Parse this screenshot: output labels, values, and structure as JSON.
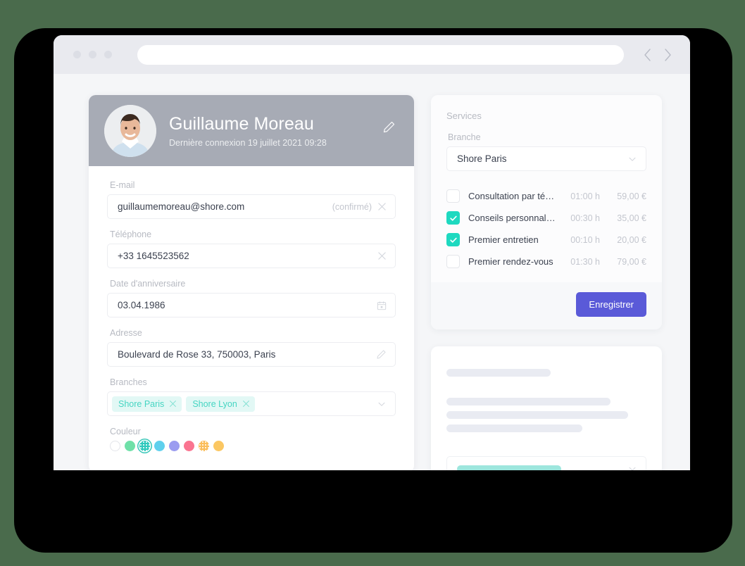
{
  "browser": {
    "url_value": "",
    "url_placeholder": "",
    "back_label": "‹",
    "forward_label": "›"
  },
  "profile": {
    "name": "Guillaume Moreau",
    "last_login": "Dernière connexion 19 juillet 2021 09:28",
    "edit_icon": "pencil-icon",
    "fields": [
      {
        "label": "E-mail",
        "value": "guillaumemoreau@shore.com",
        "hint": "(confirmé)",
        "icon": "close-icon"
      },
      {
        "label": "Téléphone",
        "value": "+33 1645523562",
        "hint": "",
        "icon": "close-icon"
      },
      {
        "label": "Date d'anniversaire",
        "value": "03.04.1986",
        "hint": "",
        "icon": "calendar-icon"
      },
      {
        "label": "Adresse",
        "value": "Boulevard de Rose 33, 750003, Paris",
        "hint": "",
        "icon": "pencil-icon"
      }
    ],
    "branches_label": "Branches",
    "branch_tags": [
      "Shore Paris",
      "Shore Lyon"
    ],
    "color_label": "Couleur",
    "colors": [
      {
        "hex": "#ffffff",
        "style": "empty",
        "selected": false
      },
      {
        "hex": "#6fe0a8",
        "style": "solid",
        "selected": false
      },
      {
        "hex": "#2ec9bd",
        "style": "dotted",
        "selected": true
      },
      {
        "hex": "#5fd0ed",
        "style": "solid",
        "selected": false
      },
      {
        "hex": "#9b9cf0",
        "style": "solid",
        "selected": false
      },
      {
        "hex": "#fa7490",
        "style": "solid",
        "selected": false
      },
      {
        "hex": "#fbbd5a",
        "style": "dotted",
        "selected": false
      },
      {
        "hex": "#fbc762",
        "style": "solid",
        "selected": false
      }
    ]
  },
  "services": {
    "title": "Services",
    "branch_label": "Branche",
    "branch_value": "Shore Paris",
    "items": [
      {
        "name": "Consultation par télép...",
        "duration": "01:00 h",
        "price": "59,00 €",
        "checked": false
      },
      {
        "name": "Conseils personnalisés",
        "duration": "00:30 h",
        "price": "35,00 €",
        "checked": true
      },
      {
        "name": "Premier entretien",
        "duration": "00:10 h",
        "price": "20,00 €",
        "checked": true
      },
      {
        "name": "Premier rendez-vous",
        "duration": "01:30 h",
        "price": "79,00 €",
        "checked": false
      }
    ],
    "save_label": "Enregistrer"
  },
  "placeholder_panel": {
    "bars": [
      {
        "width": "52%"
      },
      {
        "width": "82%"
      },
      {
        "width": "91%"
      },
      {
        "width": "68%"
      }
    ],
    "select_bar_width": "58%"
  },
  "colors": {
    "page_background": "#4a6b4c",
    "accent_teal": "#1ed9c0",
    "accent_indigo": "#5a5ad8",
    "header_grey": "#a7abb5"
  }
}
